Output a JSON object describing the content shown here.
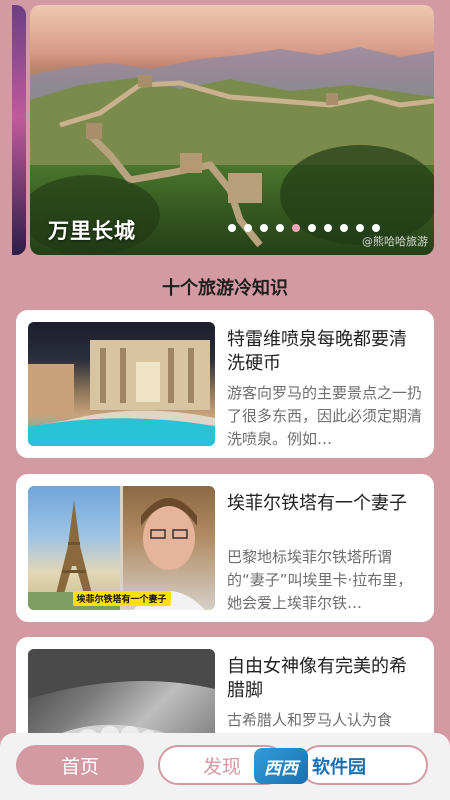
{
  "banner": {
    "title": "万里长城",
    "watermark": "@熊哈哈旅游",
    "dots_total": 10,
    "active_dot": 4
  },
  "section": {
    "title": "十个旅游冷知识"
  },
  "cards": [
    {
      "title": "特雷维喷泉每晚都要清洗硬币",
      "desc": "游客向罗马的主要景点之一扔了很多东西，因此必须定期清洗喷泉。例如…"
    },
    {
      "title": "埃菲尔铁塔有一个妻子",
      "desc": "巴黎地标埃菲尔铁塔所谓的“妻子”叫埃里卡·拉布里，她会爱上埃菲尔铁…",
      "image_caption": "埃菲尔铁塔有一个妻子"
    },
    {
      "title": "自由女神像有完美的希腊脚",
      "desc": "古希腊人和罗马人认为食"
    }
  ],
  "nav": {
    "home": "首页",
    "discover": "发现"
  },
  "site_logo": {
    "badge": "西西",
    "text": "软件园"
  },
  "colors": {
    "accent": "#d49aa3",
    "active_dot": "#f3a6b8"
  }
}
